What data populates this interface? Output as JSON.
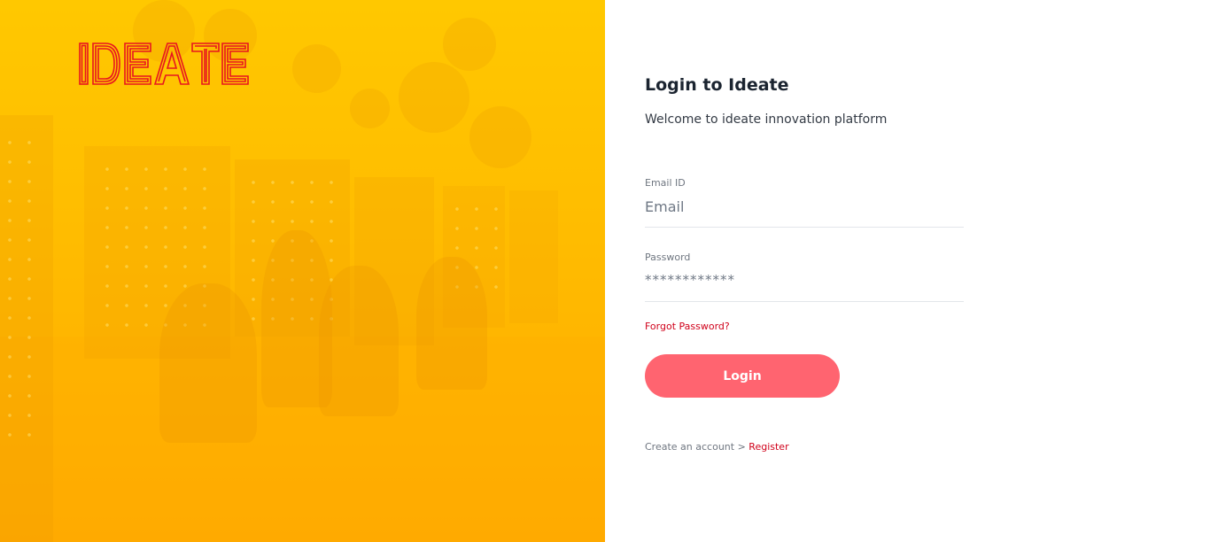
{
  "brand": {
    "logo_text": "IDEATE",
    "logo_color": "#e8161f",
    "hero_color": "#ffbb00"
  },
  "login": {
    "title": "Login to Ideate",
    "subtitle": "Welcome to ideate innovation platform",
    "email": {
      "label": "Email ID",
      "placeholder": "Email",
      "value": ""
    },
    "password": {
      "label": "Password",
      "value": "************"
    },
    "forgot_label": "Forgot Password?",
    "submit_label": "Login",
    "submit_color": "#ff6470",
    "register_prompt": "Create an account > ",
    "register_label": "Register",
    "link_color": "#d0021b"
  }
}
